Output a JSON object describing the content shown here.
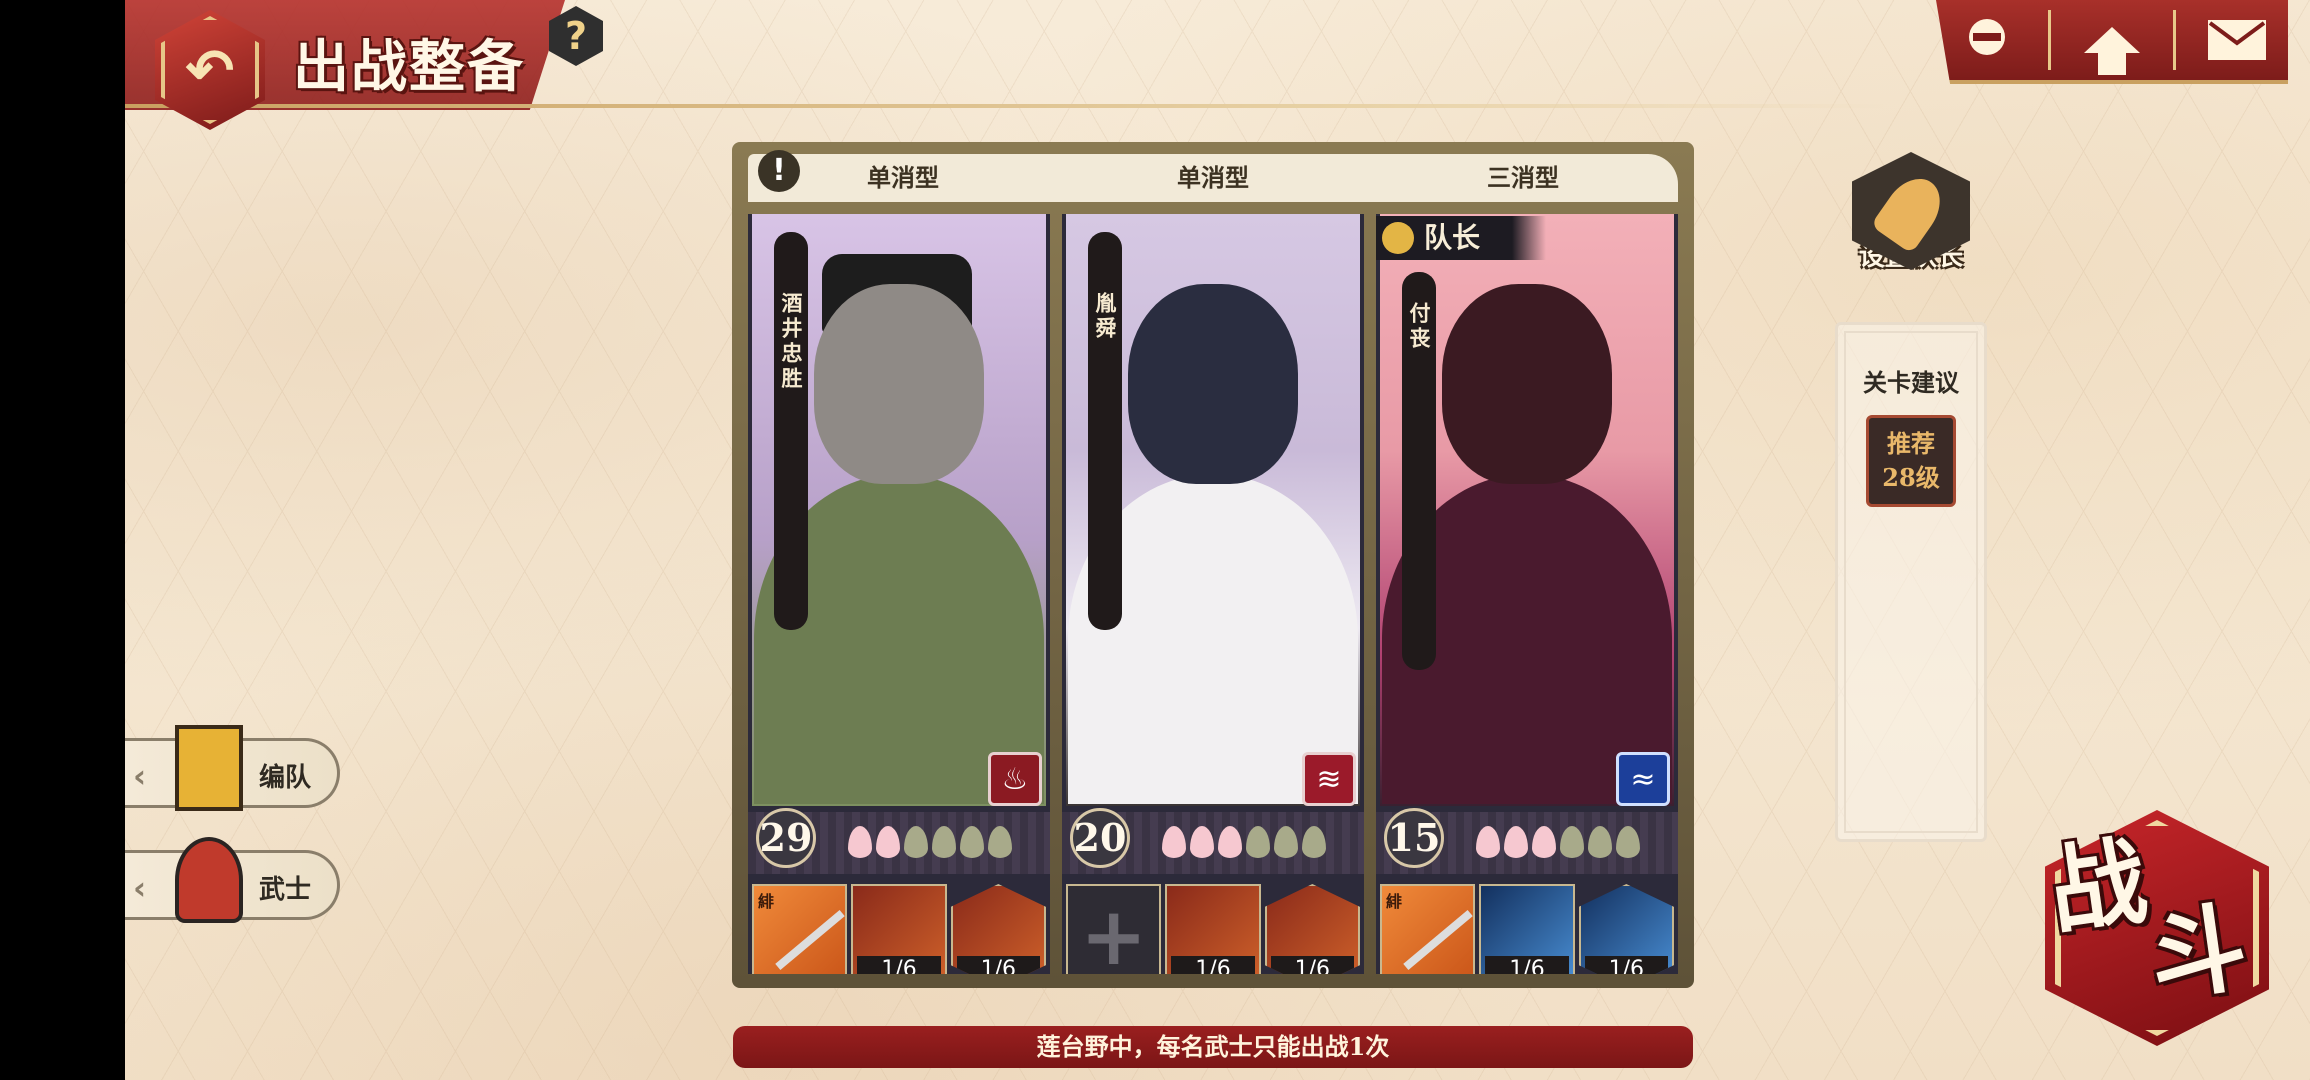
{
  "header": {
    "title": "出战整备",
    "help_label": "?"
  },
  "top_tools": [
    {
      "icon": "ninja-icon"
    },
    {
      "icon": "home-icon"
    },
    {
      "icon": "mail-icon"
    }
  ],
  "team": {
    "type_labels": [
      "单消型",
      "单消型",
      "三消型"
    ],
    "cards": [
      {
        "name": "酒井忠胜",
        "level": "29",
        "attribute": "fire",
        "petals_on": 2,
        "petals_total": 6,
        "weapon_tag": "緋",
        "skills": [
          {
            "count": "1/6"
          },
          {
            "count": "1/6"
          }
        ],
        "colors": {
          "skill": "#c95418"
        }
      },
      {
        "name": "胤舜",
        "level": "20",
        "attribute": "slash",
        "petals_on": 3,
        "petals_total": 6,
        "weapon_tag": "",
        "skills": [
          {
            "count": "1/6"
          },
          {
            "count": "1/6"
          }
        ],
        "colors": {
          "skill": "#c95418"
        }
      },
      {
        "name": "付丧",
        "leader_label": "队长",
        "level": "15",
        "attribute": "water",
        "petals_on": 3,
        "petals_total": 6,
        "weapon_tag": "緋",
        "skills": [
          {
            "count": "1/6"
          },
          {
            "count": "1/6"
          }
        ],
        "colors": {
          "skill": "#4a90d6"
        }
      }
    ]
  },
  "sidebar": {
    "set_leader_label": "设置队长",
    "advice_title": "关卡建议",
    "recommend_line1": "推荐",
    "recommend_line2": "28级"
  },
  "left_menu": {
    "formation_label": "编队",
    "samurai_label": "武士"
  },
  "notice": "莲台野中，每名武士只能出战1次",
  "battle": {
    "line1": "战",
    "line2": "斗"
  },
  "colors": {
    "accent_red": "#8e1e1c",
    "gold": "#e7c688",
    "background": "#f4e6d0"
  }
}
